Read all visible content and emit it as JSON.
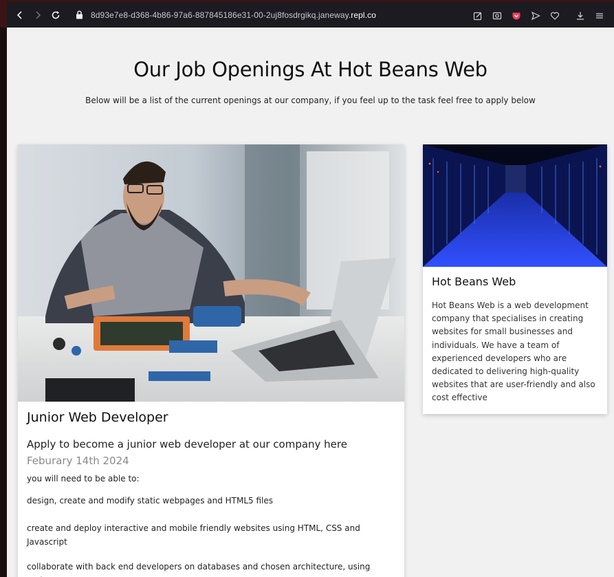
{
  "browser": {
    "url_prefix": "8d93e7e8-d368-4b86-97a6-887845186e31-00-2uj8fosdrgikq.janeway.",
    "url_domain": "repl.co",
    "icons": [
      "back-icon",
      "forward-icon",
      "reload-icon",
      "lock-icon",
      "edit-icon",
      "screenshot-icon",
      "pocket-icon",
      "send-icon",
      "heart-icon",
      "download-icon",
      "menu-icon"
    ]
  },
  "page": {
    "title": "Our Job Openings At Hot Beans Web",
    "subtitle": "Below will be a list of the current openings at our company, if you feel up to the task feel free to apply below"
  },
  "job": {
    "title": "Junior Web Developer",
    "lead": "Apply to become a junior web developer at our company here",
    "date": "Feburary 14th 2024",
    "requirements_intro": "you will need to be able to:",
    "requirements": [
      "design, create and modify static webpages and HTML5 files",
      "create and deploy interactive and mobile friendly websites using HTML, CSS and Javascript",
      "collaborate with back end developers on databases and chosen architecture, using tools"
    ]
  },
  "about": {
    "title": "Hot Beans Web",
    "body": "Hot Beans Web is a web development company that specialises in creating websites for small businesses and individuals. We have a team of experienced developers who are dedicated to delivering high-quality websites that are user-friendly and also cost effective"
  },
  "colors": {
    "page_bg": "#f1f1f1",
    "card_bg": "#ffffff",
    "date_gray": "#8a8a8a",
    "browser_bg": "#1c1b22"
  }
}
